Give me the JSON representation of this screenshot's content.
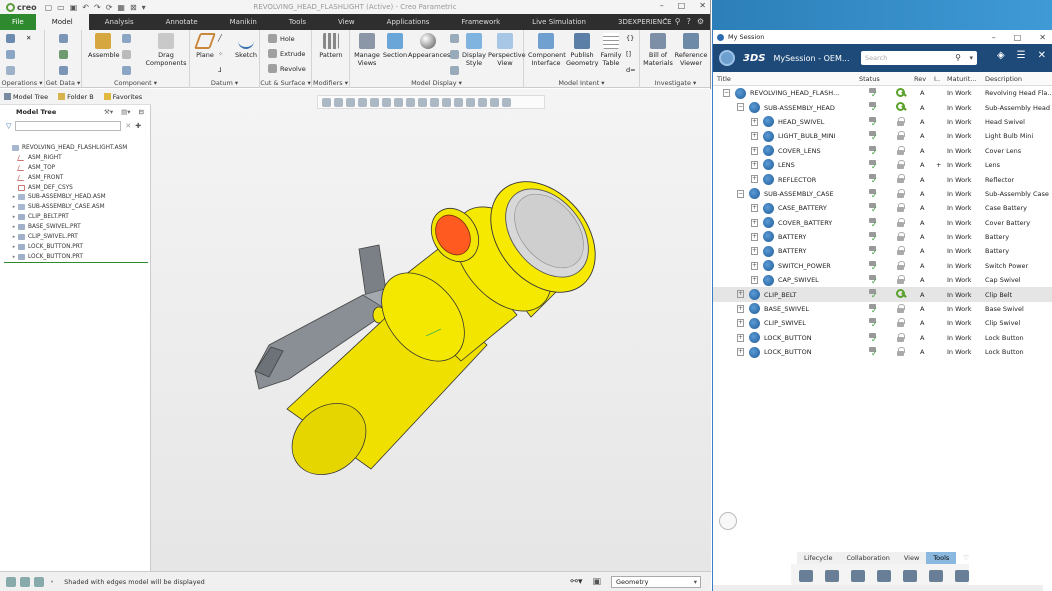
{
  "creo": {
    "brand": "creo",
    "window_title": "REVOLVING_HEAD_FLASHLIGHT (Active) - Creo Parametric",
    "tabs": [
      "File",
      "Model",
      "Analysis",
      "Annotate",
      "Manikin",
      "Tools",
      "View",
      "Applications",
      "Framework",
      "Live Simulation",
      "3DEXPERIENCE"
    ],
    "active_tab": "Model",
    "ribbon": {
      "groups": [
        {
          "label": "Operations ▾"
        },
        {
          "label": "Get Data ▾"
        },
        {
          "label": "Component ▾"
        },
        {
          "label": "Datum ▾"
        },
        {
          "label": "Cut & Surface ▾"
        },
        {
          "label": "Modifiers ▾"
        },
        {
          "label": "Model Display ▾"
        },
        {
          "label": "Model Intent ▾"
        },
        {
          "label": "Investigate ▾"
        }
      ],
      "buttons": {
        "assemble": "Assemble",
        "drag_components": "Drag Components",
        "plane": "Plane",
        "sketch": "Sketch",
        "hole": "Hole",
        "extrude": "Extrude",
        "revolve": "Revolve",
        "pattern": "Pattern",
        "manage_views": "Manage Views",
        "section": "Section",
        "appearances": "Appearances",
        "display_style": "Display Style",
        "perspective_view": "Perspective View",
        "component_interface": "Component Interface",
        "publish_geometry": "Publish Geometry",
        "family_table": "Family Table",
        "bill_of_materials": "Bill of Materials",
        "reference_viewer": "Reference Viewer"
      }
    },
    "panel_tabs": [
      "Model Tree",
      "Folder B",
      "Favorites"
    ],
    "model_tree": {
      "title": "Model Tree",
      "items": [
        {
          "label": "REVOLVING_HEAD_FLASHLIGHT.ASM",
          "kind": "asm",
          "level": 0,
          "expandable": false
        },
        {
          "label": "ASM_RIGHT",
          "kind": "datum",
          "level": 1,
          "expandable": false
        },
        {
          "label": "ASM_TOP",
          "kind": "datum",
          "level": 1,
          "expandable": false
        },
        {
          "label": "ASM_FRONT",
          "kind": "datum",
          "level": 1,
          "expandable": false
        },
        {
          "label": "ASM_DEF_CSYS",
          "kind": "csys",
          "level": 1,
          "expandable": false
        },
        {
          "label": "SUB-ASSEMBLY_HEAD.ASM",
          "kind": "asm",
          "level": 1,
          "expandable": true
        },
        {
          "label": "SUB-ASSEMBLY_CASE.ASM",
          "kind": "asm",
          "level": 1,
          "expandable": true
        },
        {
          "label": "CLIP_BELT.PRT",
          "kind": "prt",
          "level": 1,
          "expandable": true
        },
        {
          "label": "BASE_SWIVEL.PRT",
          "kind": "prt",
          "level": 1,
          "expandable": true
        },
        {
          "label": "CLIP_SWIVEL.PRT",
          "kind": "prt",
          "level": 1,
          "expandable": true
        },
        {
          "label": "LOCK_BUTTON.PRT",
          "kind": "prt",
          "level": 1,
          "expandable": true
        },
        {
          "label": "LOCK_BUTTON.PRT",
          "kind": "prt",
          "level": 1,
          "expandable": true
        }
      ]
    },
    "status_message": "Shaded with edges model will be displayed",
    "filter_select": "Geometry",
    "colors": {
      "file_tab": "#2f8a2f",
      "tab_bar": "#2e2e2e",
      "model_yellow": "#f2e600",
      "model_orange": "#ff5a1f",
      "clip_grey": "#8a8f96"
    }
  },
  "session": {
    "window_title": "My Session",
    "name": "MySession - OEM...",
    "search_placeholder": "Search",
    "columns": {
      "title": "Title",
      "status": "Status",
      "rev": "Rev",
      "i": "I..",
      "maturity": "Maturit...",
      "description": "Description"
    },
    "rows": [
      {
        "title": "REVOLVING_HEAD_FLASH...",
        "level": 0,
        "exp": "−",
        "lock": "key",
        "rev": "A",
        "flag": "",
        "maturity": "In Work",
        "description": "Revolving Head Fla...",
        "selected": false
      },
      {
        "title": "SUB-ASSEMBLY_HEAD",
        "level": 1,
        "exp": "−",
        "lock": "key",
        "rev": "A",
        "flag": "",
        "maturity": "In Work",
        "description": "Sub-Assembly Head",
        "selected": false
      },
      {
        "title": "HEAD_SWIVEL",
        "level": 2,
        "exp": "+",
        "lock": "grey",
        "rev": "A",
        "flag": "",
        "maturity": "In Work",
        "description": "Head Swivel",
        "selected": false
      },
      {
        "title": "LIGHT_BULB_MINI",
        "level": 2,
        "exp": "+",
        "lock": "grey",
        "rev": "A",
        "flag": "",
        "maturity": "In Work",
        "description": "Light Bulb Mini",
        "selected": false
      },
      {
        "title": "COVER_LENS",
        "level": 2,
        "exp": "+",
        "lock": "grey",
        "rev": "A",
        "flag": "",
        "maturity": "In Work",
        "description": "Cover Lens",
        "selected": false
      },
      {
        "title": "LENS",
        "level": 2,
        "exp": "+",
        "lock": "grey",
        "rev": "A",
        "flag": "+",
        "maturity": "In Work",
        "description": "Lens",
        "selected": false
      },
      {
        "title": "REFLECTOR",
        "level": 2,
        "exp": "+",
        "lock": "grey",
        "rev": "A",
        "flag": "",
        "maturity": "In Work",
        "description": "Reflector",
        "selected": false
      },
      {
        "title": "SUB-ASSEMBLY_CASE",
        "level": 1,
        "exp": "−",
        "lock": "grey",
        "rev": "A",
        "flag": "",
        "maturity": "In Work",
        "description": "Sub-Assembly Case",
        "selected": false
      },
      {
        "title": "CASE_BATTERY",
        "level": 2,
        "exp": "+",
        "lock": "grey",
        "rev": "A",
        "flag": "",
        "maturity": "In Work",
        "description": "Case Battery",
        "selected": false
      },
      {
        "title": "COVER_BATTERY",
        "level": 2,
        "exp": "+",
        "lock": "grey",
        "rev": "A",
        "flag": "",
        "maturity": "In Work",
        "description": "Cover Battery",
        "selected": false
      },
      {
        "title": "BATTERY",
        "level": 2,
        "exp": "+",
        "lock": "grey",
        "rev": "A",
        "flag": "",
        "maturity": "In Work",
        "description": "Battery",
        "selected": false
      },
      {
        "title": "BATTERY",
        "level": 2,
        "exp": "+",
        "lock": "grey",
        "rev": "A",
        "flag": "",
        "maturity": "In Work",
        "description": "Battery",
        "selected": false
      },
      {
        "title": "SWITCH_POWER",
        "level": 2,
        "exp": "+",
        "lock": "grey",
        "rev": "A",
        "flag": "",
        "maturity": "In Work",
        "description": "Switch Power",
        "selected": false
      },
      {
        "title": "CAP_SWIVEL",
        "level": 2,
        "exp": "+",
        "lock": "grey",
        "rev": "A",
        "flag": "",
        "maturity": "In Work",
        "description": "Cap Swivel",
        "selected": false
      },
      {
        "title": "CLIP_BELT",
        "level": 1,
        "exp": "+",
        "lock": "key",
        "rev": "A",
        "flag": "",
        "maturity": "In Work",
        "description": "Clip Belt",
        "selected": true
      },
      {
        "title": "BASE_SWIVEL",
        "level": 1,
        "exp": "+",
        "lock": "grey",
        "rev": "A",
        "flag": "",
        "maturity": "In Work",
        "description": "Base Swivel",
        "selected": false
      },
      {
        "title": "CLIP_SWIVEL",
        "level": 1,
        "exp": "+",
        "lock": "grey",
        "rev": "A",
        "flag": "",
        "maturity": "In Work",
        "description": "Clip Swivel",
        "selected": false
      },
      {
        "title": "LOCK_BUTTON",
        "level": 1,
        "exp": "+",
        "lock": "grey",
        "rev": "A",
        "flag": "",
        "maturity": "In Work",
        "description": "Lock Button",
        "selected": false
      },
      {
        "title": "LOCK_BUTTON",
        "level": 1,
        "exp": "+",
        "lock": "grey",
        "rev": "A",
        "flag": "",
        "maturity": "In Work",
        "description": "Lock Button",
        "selected": false
      }
    ],
    "bottom_tabs": [
      "Lifecycle",
      "Collaboration",
      "View",
      "Tools"
    ],
    "active_bottom_tab": "Tools",
    "colors": {
      "header": "#1d4a78",
      "selected_row": "#e5e5e5",
      "active_tab": "#8bb8de"
    }
  }
}
